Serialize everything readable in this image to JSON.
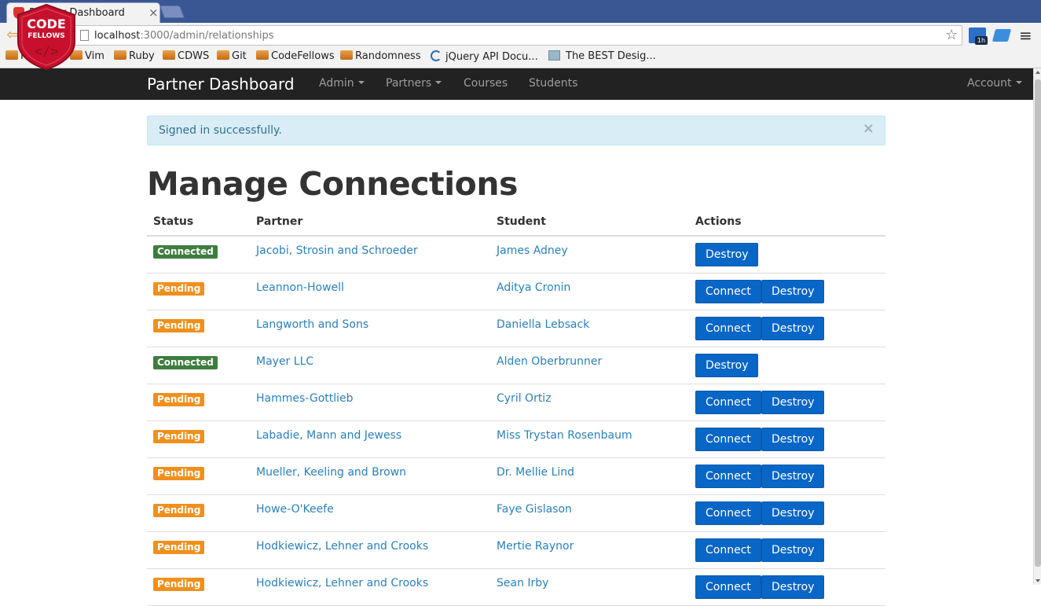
{
  "browser": {
    "tab_title": "Partner Dashboard",
    "tab_close": "×",
    "url_host": "localhost",
    "url_path": ":3000/admin/relationships",
    "ext_badge": "1h",
    "bookmarks": [
      "Recipies",
      "Vim",
      "Ruby",
      "CDWS",
      "Git",
      "CodeFellows",
      "Randomness",
      "jQuery API Docu...",
      "The BEST Desig..."
    ]
  },
  "logo": {
    "line1": "CODE",
    "line2": "FELLOWS",
    "glyph": "</>"
  },
  "nav": {
    "brand": "Partner Dashboard",
    "admin": "Admin",
    "partners": "Partners",
    "courses": "Courses",
    "students": "Students",
    "account": "Account"
  },
  "alert": {
    "message": "Signed in successfully.",
    "close": "×"
  },
  "page": {
    "title": "Manage Connections"
  },
  "table": {
    "headers": [
      "Status",
      "Partner",
      "Student",
      "Actions"
    ],
    "connect_label": "Connect",
    "destroy_label": "Destroy",
    "rows": [
      {
        "status": "Connected",
        "partner": "Jacobi, Strosin and Schroeder",
        "student": "James Adney"
      },
      {
        "status": "Pending",
        "partner": "Leannon-Howell",
        "student": "Aditya Cronin"
      },
      {
        "status": "Pending",
        "partner": "Langworth and Sons",
        "student": "Daniella Lebsack"
      },
      {
        "status": "Connected",
        "partner": "Mayer LLC",
        "student": "Alden Oberbrunner"
      },
      {
        "status": "Pending",
        "partner": "Hammes-Gottlieb",
        "student": "Cyril Ortiz"
      },
      {
        "status": "Pending",
        "partner": "Labadie, Mann and Jewess",
        "student": "Miss Trystan Rosenbaum"
      },
      {
        "status": "Pending",
        "partner": "Mueller, Keeling and Brown",
        "student": "Dr. Mellie Lind"
      },
      {
        "status": "Pending",
        "partner": "Howe-O'Keefe",
        "student": "Faye Gislason"
      },
      {
        "status": "Pending",
        "partner": "Hodkiewicz, Lehner and Crooks",
        "student": "Mertie Raynor"
      },
      {
        "status": "Pending",
        "partner": "Hodkiewicz, Lehner and Crooks",
        "student": "Sean Irby"
      }
    ]
  },
  "colors": {
    "connected": "#3d7e3e",
    "pending": "#f0901c",
    "link": "#2a80b9",
    "button": "#0866c6"
  }
}
